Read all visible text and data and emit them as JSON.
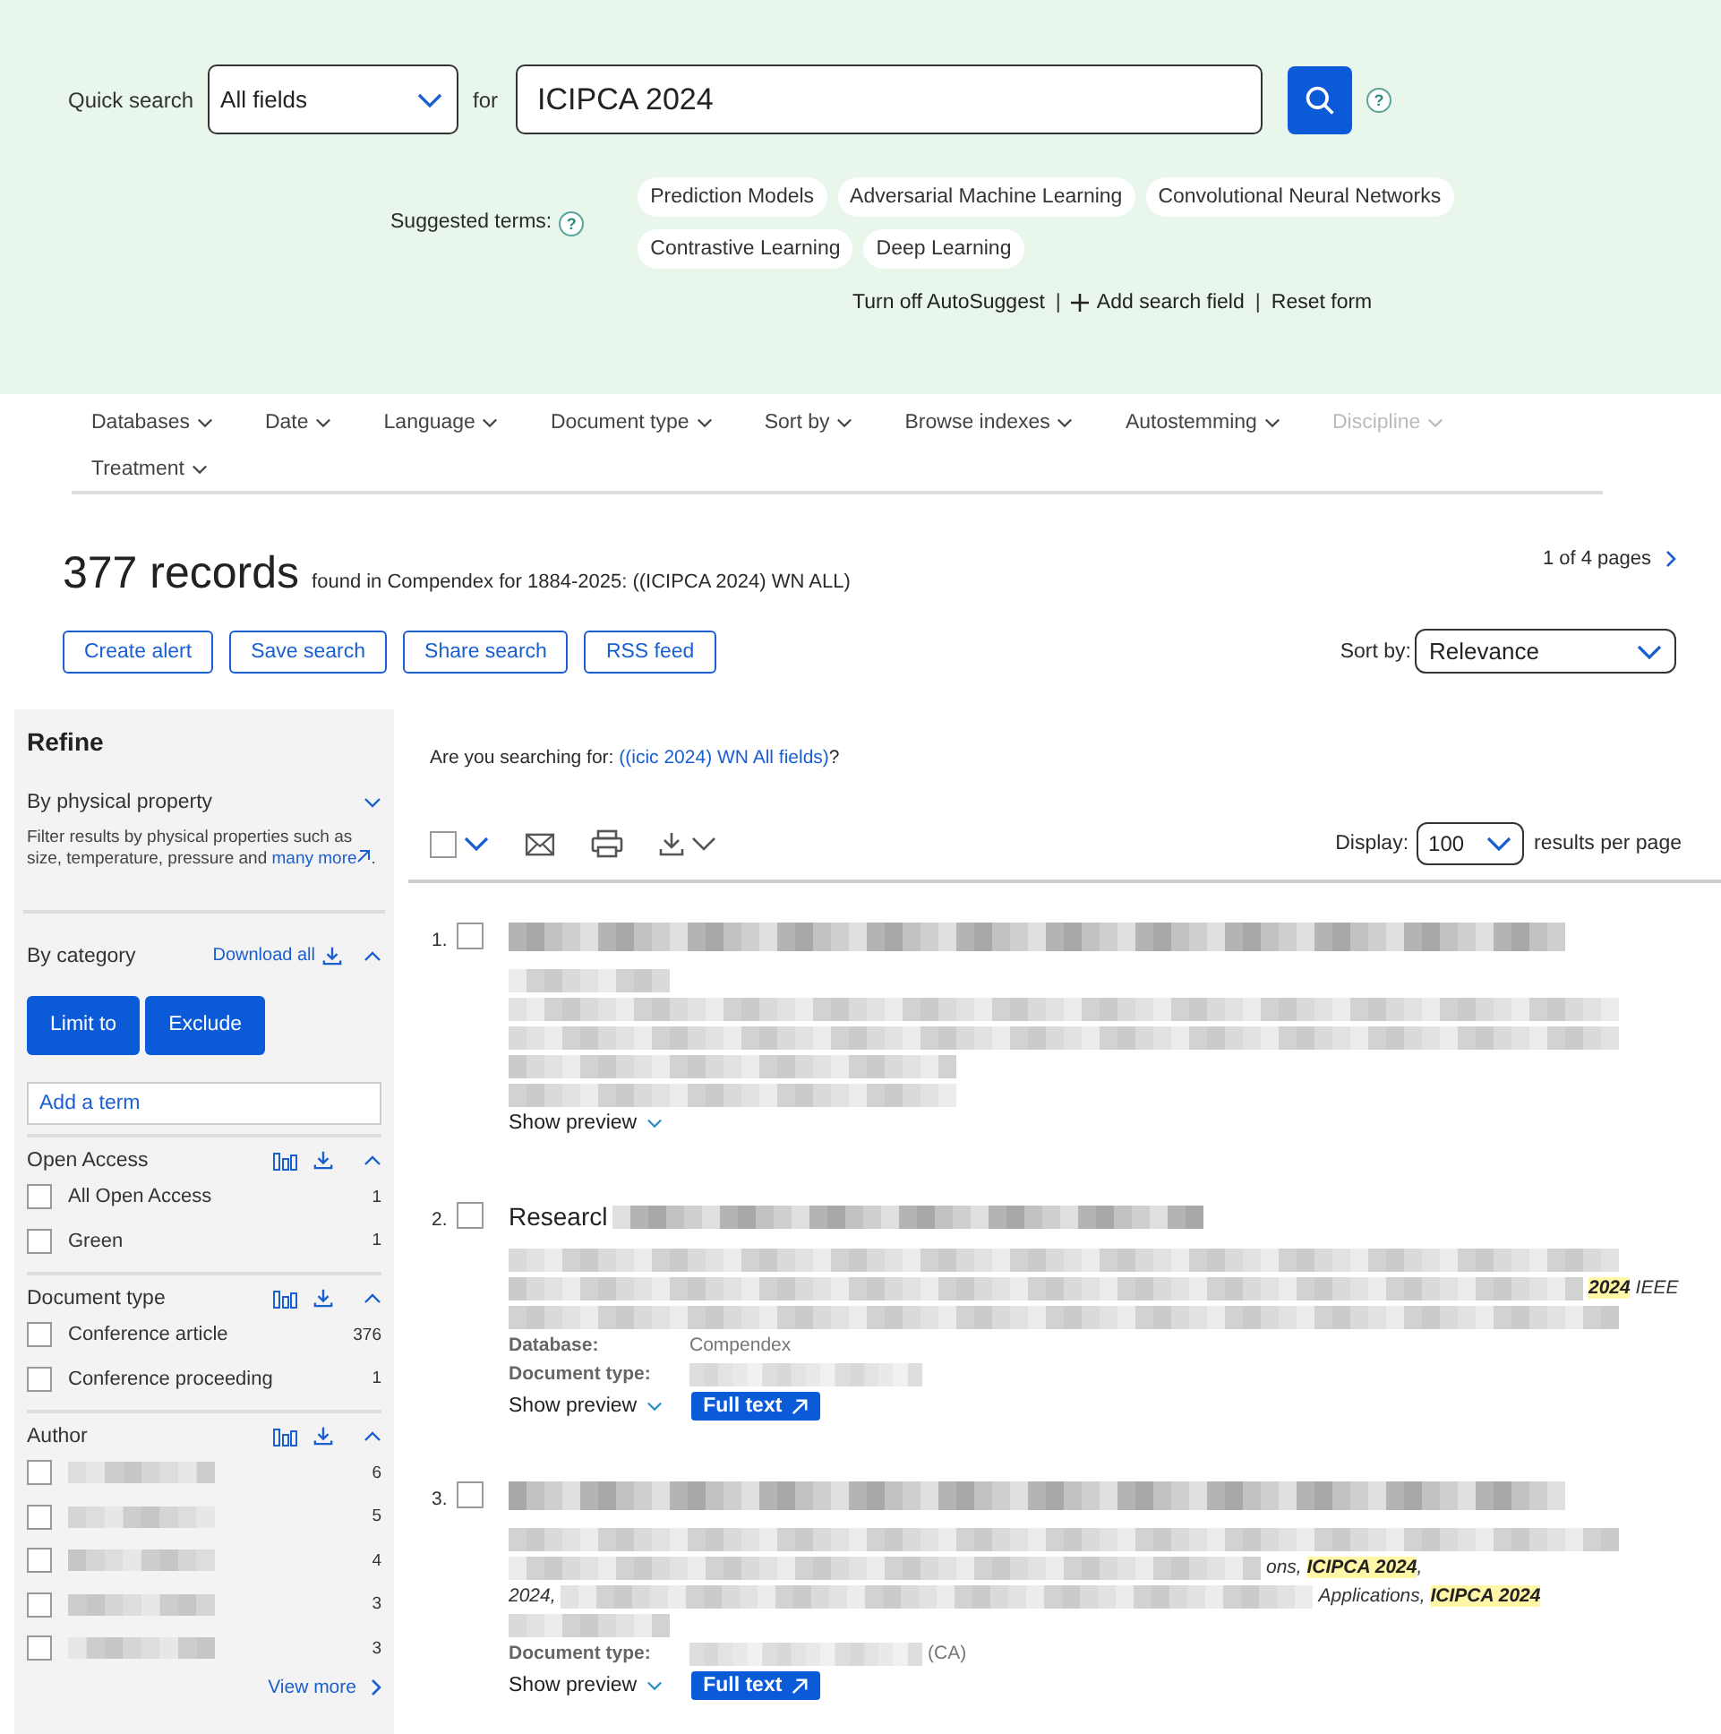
{
  "search": {
    "label": "Quick search",
    "field_select": "All fields",
    "for_label": "for",
    "query": "ICIPCA 2024",
    "help": "?"
  },
  "suggested": {
    "label": "Suggested terms:",
    "help": "?",
    "terms": [
      "Prediction Models",
      "Adversarial Machine Learning",
      "Convolutional Neural Networks",
      "Contrastive Learning",
      "Deep Learning"
    ]
  },
  "links": {
    "separator": "|",
    "items": [
      {
        "kind": "plain",
        "text": "Turn off AutoSuggest"
      },
      {
        "kind": "add",
        "text": "Add search field"
      },
      {
        "kind": "plain",
        "text": "Reset form"
      }
    ]
  },
  "filters": [
    {
      "label": "Databases",
      "disabled": false
    },
    {
      "label": "Date",
      "disabled": false
    },
    {
      "label": "Language",
      "disabled": false
    },
    {
      "label": "Document type",
      "disabled": false
    },
    {
      "label": "Sort by",
      "disabled": false
    },
    {
      "label": "Browse indexes",
      "disabled": false
    },
    {
      "label": "Autostemming",
      "disabled": false
    },
    {
      "label": "Discipline",
      "disabled": true
    },
    {
      "label": "Treatment",
      "disabled": false
    }
  ],
  "results_header": {
    "count": "377 records",
    "found_text": "found in Compendex for 1884-2025: ((ICIPCA 2024) WN ALL)",
    "pages": "1 of 4 pages",
    "actions": [
      "Create alert",
      "Save search",
      "Share search",
      "RSS feed"
    ],
    "sort_label": "Sort by:",
    "sort_value": "Relevance"
  },
  "refine": {
    "title": "Refine",
    "physical": {
      "title": "By physical property",
      "expanded": false,
      "description": "Filter results by physical properties such as size, temperature, pressure and",
      "link": "many more",
      "suffix": "."
    },
    "category": {
      "title": "By category",
      "expanded": true,
      "download": "Download all",
      "buttons": [
        "Limit to",
        "Exclude"
      ],
      "term_placeholder": "Add a term"
    },
    "facets": [
      {
        "title": "Open Access",
        "expanded": true,
        "items": [
          {
            "kind": "text",
            "label": "All Open Access",
            "count": "1",
            "checked": false
          },
          {
            "kind": "text",
            "label": "Green",
            "count": "1",
            "checked": false
          }
        ]
      },
      {
        "title": "Document type",
        "expanded": true,
        "items": [
          {
            "kind": "text",
            "label": "Conference article",
            "count": "376",
            "checked": false
          },
          {
            "kind": "text",
            "label": "Conference proceeding",
            "count": "1",
            "checked": false
          }
        ]
      },
      {
        "title": "Author",
        "expanded": true,
        "items": [
          {
            "kind": "blurred",
            "count": "6",
            "checked": false
          },
          {
            "kind": "blurred",
            "count": "5",
            "checked": false
          },
          {
            "kind": "blurred",
            "count": "4",
            "checked": false
          },
          {
            "kind": "blurred",
            "count": "3",
            "checked": false
          },
          {
            "kind": "blurred",
            "count": "3",
            "checked": false
          }
        ]
      }
    ],
    "view_more": "View more"
  },
  "suggestion": {
    "prefix": "Are you searching for:",
    "link": "((icic 2024) WN All fields)",
    "suffix": "?"
  },
  "toolbar": {
    "select_all_checked": false,
    "display_label": "Display:",
    "display_value": "100",
    "per_page": "results per page"
  },
  "results": [
    {
      "number": "1.",
      "checked": false,
      "lines": [
        {
          "kind": "blur"
        },
        {
          "kind": "blur"
        },
        {
          "kind": "blur"
        },
        {
          "kind": "blur"
        },
        {
          "kind": "blur"
        },
        {
          "kind": "blur"
        }
      ],
      "preview": "Show preview"
    },
    {
      "number": "2.",
      "checked": false,
      "lines": [
        {
          "kind": "title",
          "text": "Researcl"
        },
        {
          "kind": "blur"
        },
        {
          "kind": "blur",
          "tail": "**2024** IEEE"
        },
        {
          "kind": "blur"
        },
        {
          "kind": "meta",
          "label": "Database:",
          "value": "Compendex"
        },
        {
          "kind": "meta",
          "label": "Document type:"
        }
      ],
      "preview": "Show preview",
      "full_text": "Full text"
    },
    {
      "number": "3.",
      "checked": false,
      "lines": [
        {
          "kind": "blur"
        },
        {
          "kind": "blur"
        },
        {
          "kind": "blur",
          "tail": "ons, **ICIPCA 2024**,"
        },
        {
          "kind": "blur",
          "lead": "2024,",
          "tail": "Applications, **ICIPCA 2024**"
        },
        {
          "kind": "blur"
        },
        {
          "kind": "meta",
          "label": "Document type:",
          "value": "(CA)"
        }
      ],
      "preview": "Show preview",
      "full_text": "Full text"
    }
  ]
}
